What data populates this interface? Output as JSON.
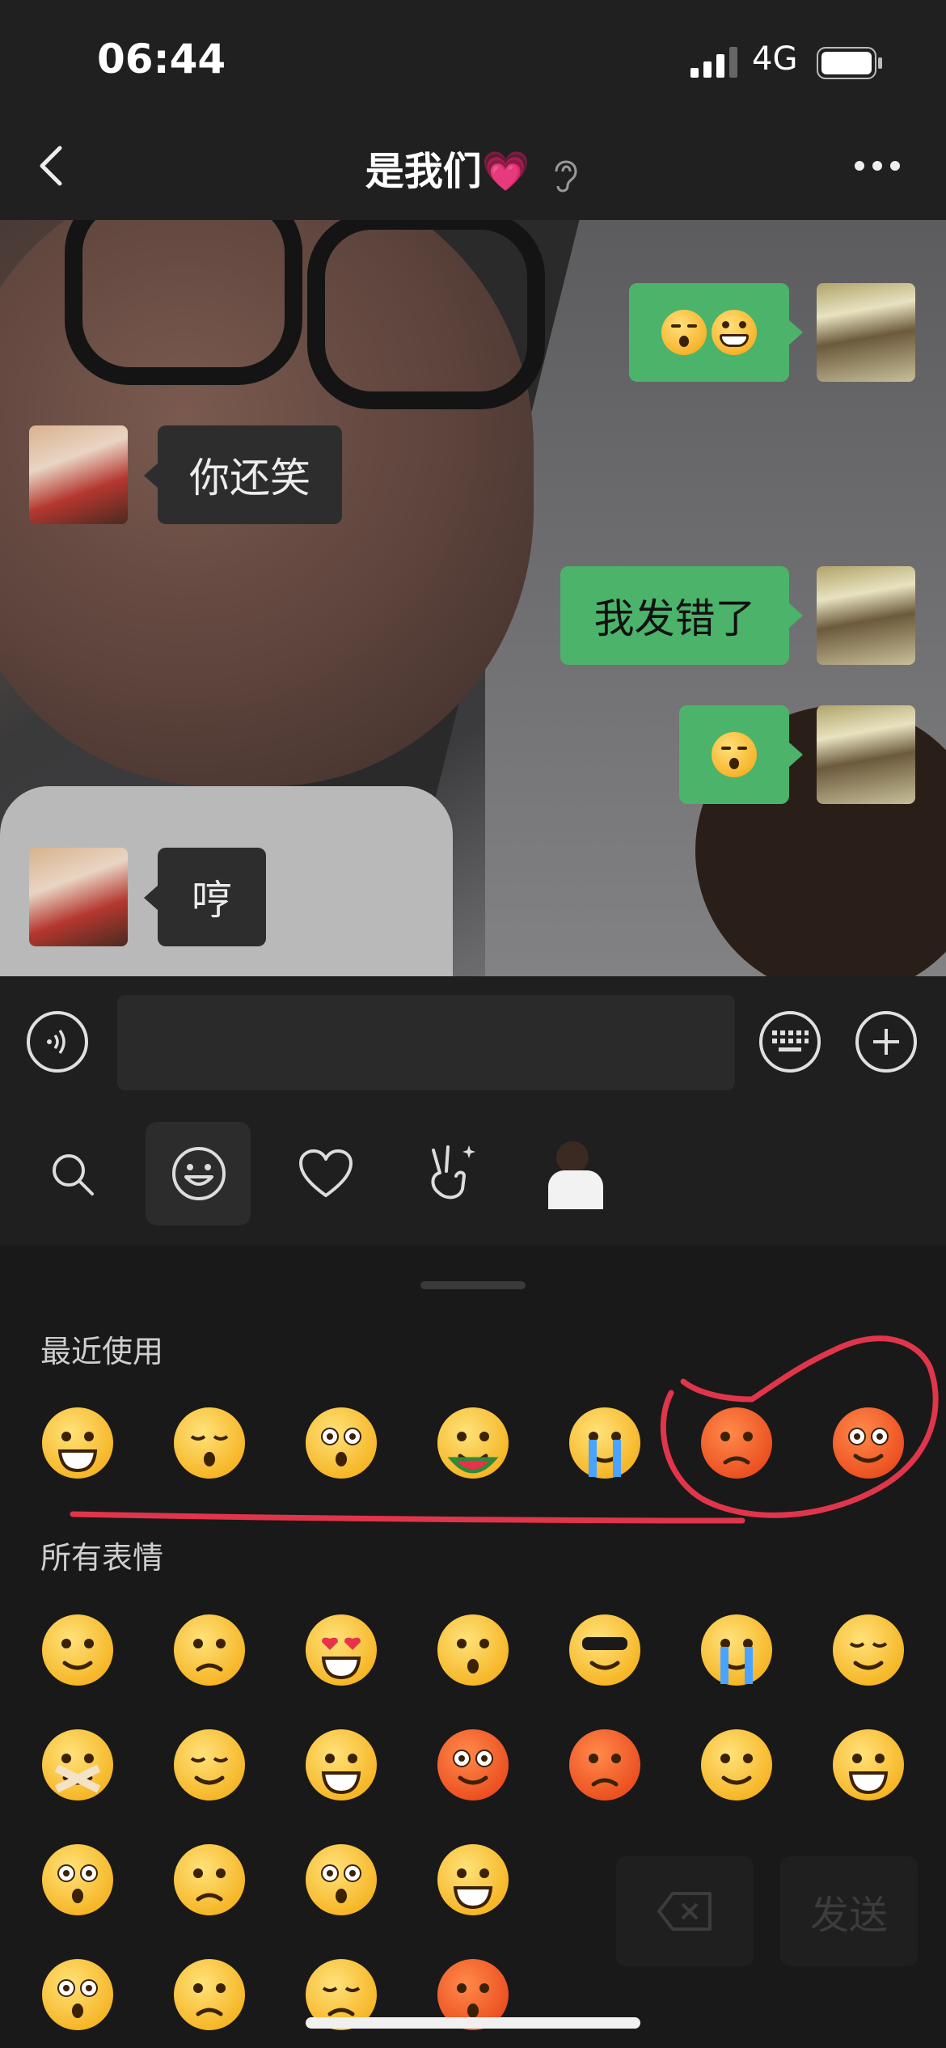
{
  "status_bar": {
    "time": "06:44",
    "carrier": "4G"
  },
  "header": {
    "title": "是我们💗",
    "back_icon": "chevron-left-icon",
    "more_icon": "ellipsis-icon"
  },
  "messages": [
    {
      "side": "out",
      "kind": "emoji",
      "emojis": [
        "sleepy-face",
        "grin-face"
      ]
    },
    {
      "side": "in",
      "text": "你还笑"
    },
    {
      "side": "out",
      "text": "我发错了"
    },
    {
      "side": "out",
      "kind": "emoji",
      "emojis": [
        "sleepy-face"
      ]
    },
    {
      "side": "in",
      "text": "哼"
    }
  ],
  "input": {
    "placeholder": ""
  },
  "emoji_tabs": [
    "search-icon",
    "smiley-icon",
    "heart-icon",
    "gesture-icon",
    "sticker-thumb"
  ],
  "panel": {
    "recent_title": "最近使用",
    "all_title": "所有表情",
    "recent": [
      "grin",
      "sleepy",
      "shy",
      "watermelon",
      "cry",
      "angry",
      "sweat"
    ],
    "all_rows": [
      [
        "smile",
        "worried",
        "heart-eyes",
        "surprised",
        "cool",
        "cry",
        "shy-smile"
      ],
      [
        "shush",
        "sleep",
        "tears-laugh",
        "sweat",
        "angry",
        "wink-tongue",
        "grin"
      ],
      [
        "shocked",
        "sad",
        "shy",
        "laugh"
      ],
      [
        "shocked-2",
        "doubt",
        "bored",
        "scream"
      ]
    ],
    "send_label": "发送"
  },
  "colors": {
    "bubble_out": "#4cb36b",
    "bubble_in": "#2d2d2d",
    "panel_bg": "#191919",
    "annotation": "#e0354a"
  }
}
